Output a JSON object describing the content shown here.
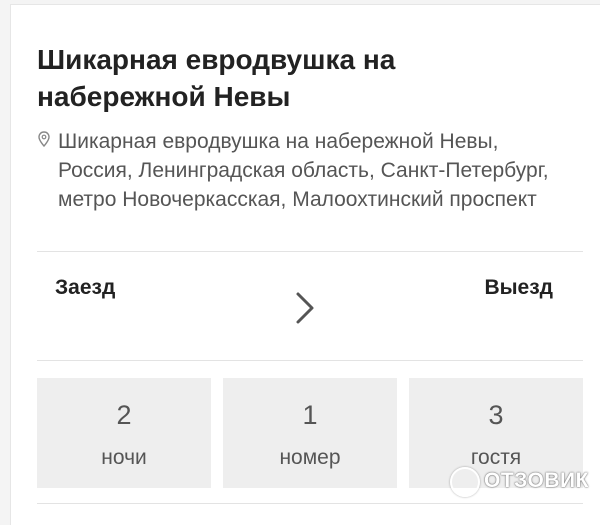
{
  "listing": {
    "title": "Шикарная евродвушка на набережной Невы",
    "address": "Шикарная евродвушка на набережной Невы, Россия, Ленинградская область, Санкт-Петербург, метро Новочеркасская, Малоохтинский проспект",
    "address_icon": "map-pin-icon"
  },
  "dates": {
    "checkin_label": "Заезд",
    "checkout_label": "Выезд",
    "arrow_icon": "chevron-right-icon"
  },
  "counters": [
    {
      "value": "2",
      "label": "ночи"
    },
    {
      "value": "1",
      "label": "номер"
    },
    {
      "value": "3",
      "label": "гостя"
    }
  ],
  "watermark": {
    "text": "ОТЗОВИК"
  }
}
